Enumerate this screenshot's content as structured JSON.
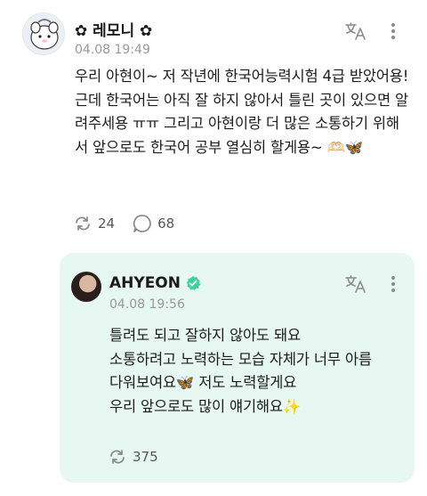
{
  "post": {
    "author": "✿ 레모니 ✿",
    "timestamp": "04.08 19:49",
    "text": "우리 아현이~ 저 작년에 한국어능력시험 4급 받았어용! 근데 한국어는 아직 잘 하지 않아서 틀린 곳이 있으면 알려주세용 ㅠㅠ 그리고 아현이랑 더 많은 소통하기 위해서 앞으로도 한국어 공부 열심히 할게용~ 🫶🏻🦋",
    "repost_count": "24",
    "comment_count": "68"
  },
  "reply": {
    "author": "AHYEON",
    "timestamp": "04.08 19:56",
    "lines": [
      "틀려도 되고 잘하지 않아도 돼요",
      "소통하려고 노력하는 모습 자체가 너무 아름",
      "다워보여요🦋 저도 노력할게요",
      "우리 앞으로도 많이 얘기해요✨"
    ],
    "repost_count": "375"
  },
  "icons": {
    "translate": "translate-icon",
    "more": "more-vertical-icon",
    "repost": "repost-icon",
    "comment": "comment-icon",
    "verified": "verified-badge-icon"
  },
  "colors": {
    "reply_background": "#e7f7f1",
    "verified_badge": "#3ad29f",
    "icon_gray": "#8a8a8a"
  }
}
